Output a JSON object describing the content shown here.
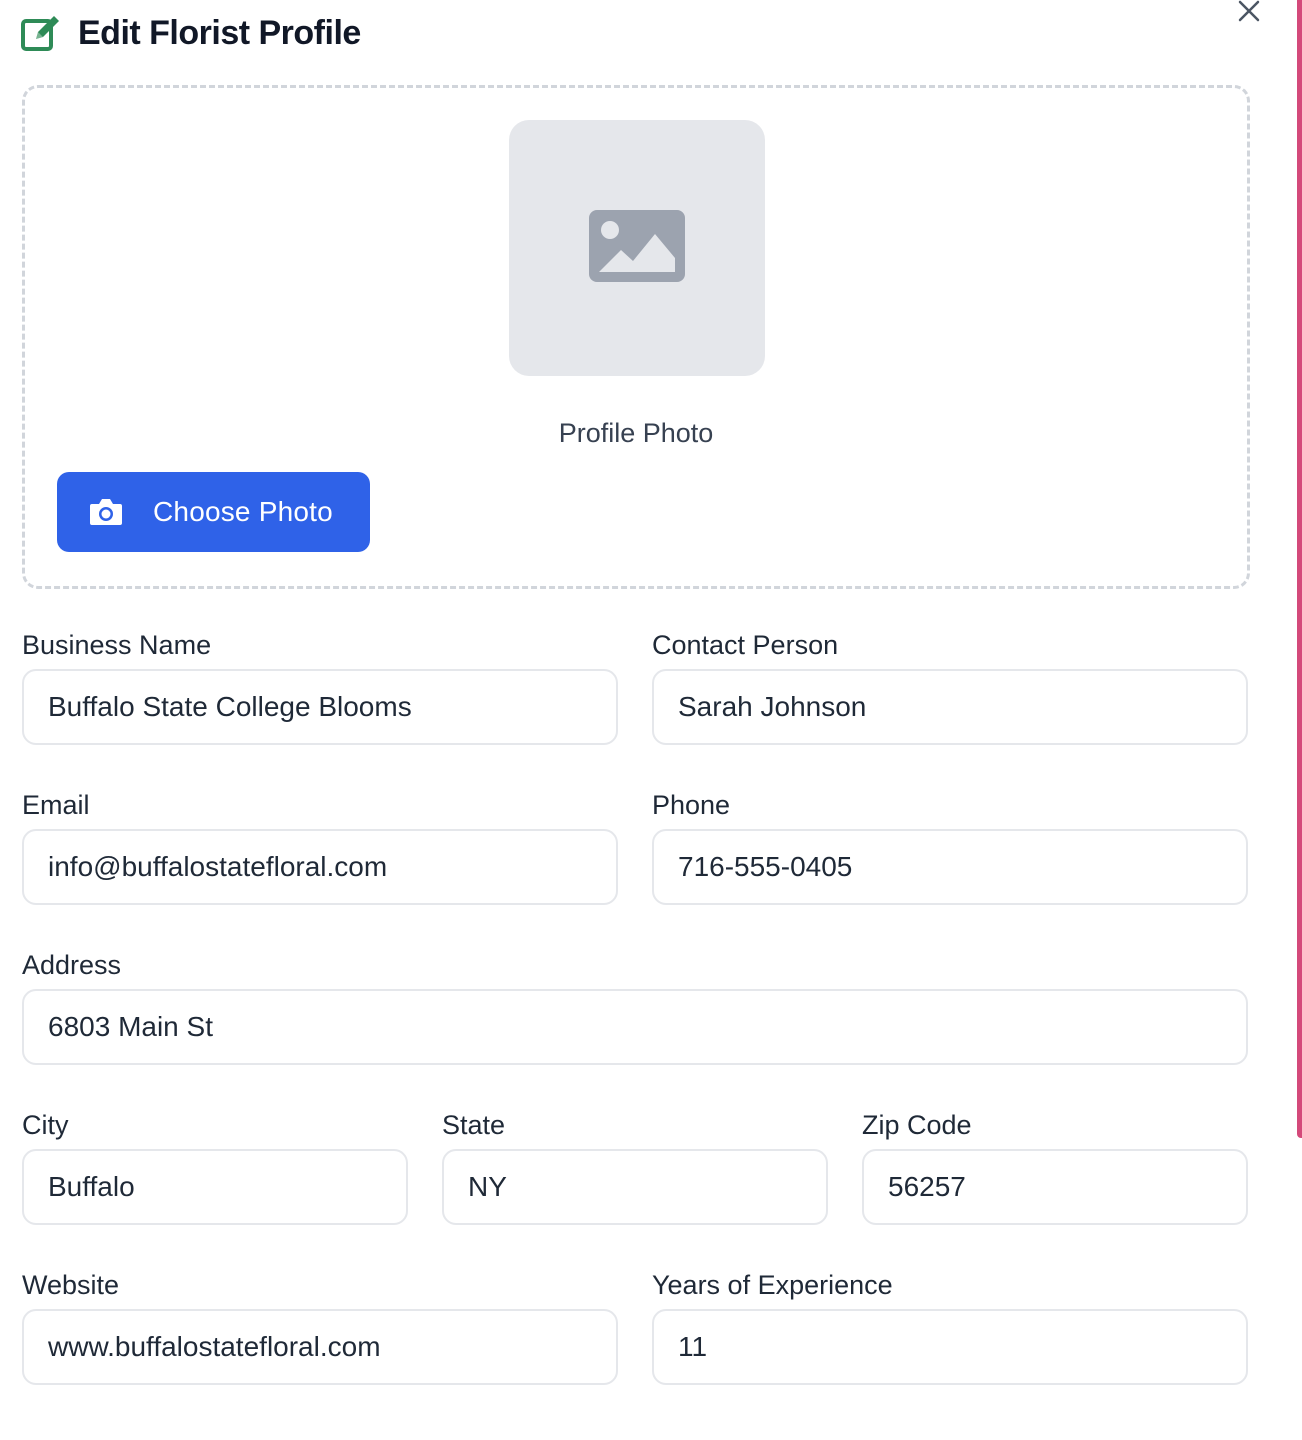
{
  "header": {
    "title": "Edit Florist Profile",
    "title_icon": "edit-icon",
    "close_icon": "close-icon"
  },
  "photo": {
    "placeholder_icon": "image-icon",
    "label": "Profile Photo",
    "choose_button": "Choose Photo",
    "choose_icon": "camera-icon"
  },
  "form": {
    "business_name": {
      "label": "Business Name",
      "value": "Buffalo State College Blooms"
    },
    "contact_person": {
      "label": "Contact Person",
      "value": "Sarah Johnson"
    },
    "email": {
      "label": "Email",
      "value": "info@buffalostatefloral.com"
    },
    "phone": {
      "label": "Phone",
      "value": "716-555-0405"
    },
    "address": {
      "label": "Address",
      "value": "6803 Main St"
    },
    "city": {
      "label": "City",
      "value": "Buffalo"
    },
    "state": {
      "label": "State",
      "value": "NY"
    },
    "zip": {
      "label": "Zip Code",
      "value": "56257"
    },
    "website": {
      "label": "Website",
      "value": "www.buffalostatefloral.com"
    },
    "years_experience": {
      "label": "Years of Experience",
      "value": "11"
    }
  },
  "colors": {
    "primary": "#2f62e8",
    "edit_icon": "#2e8b57",
    "scroll_accent": "#d4497a",
    "border": "#e5e7eb",
    "placeholder_bg": "#e5e7eb"
  }
}
